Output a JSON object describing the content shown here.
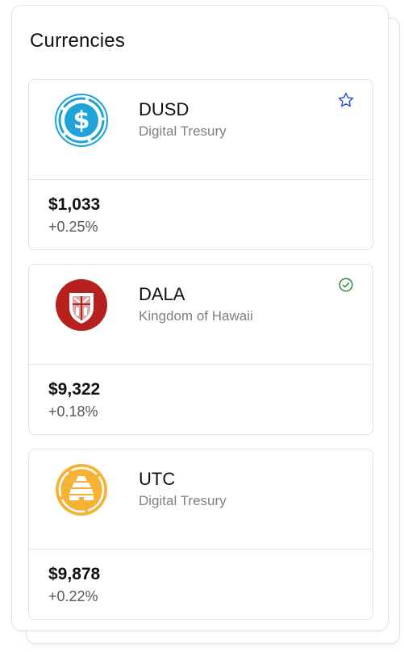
{
  "panel": {
    "title": "Currencies"
  },
  "currencies": [
    {
      "symbol": "DUSD",
      "issuer": "Digital Tresury",
      "price": "$1,033",
      "change": "+0.25%",
      "logo_icon": "dollar-coin-icon",
      "badge_icon": "star-outline-icon",
      "accent": "#1fa3d8"
    },
    {
      "symbol": "DALA",
      "issuer": "Kingdom of Hawaii",
      "price": "$9,322",
      "change": "+0.18%",
      "logo_icon": "hawaii-crest-icon",
      "badge_icon": "verified-check-icon",
      "accent": "#b6201e"
    },
    {
      "symbol": "UTC",
      "issuer": "Digital Tresury",
      "price": "$9,878",
      "change": "+0.22%",
      "logo_icon": "beehive-coin-icon",
      "badge_icon": "",
      "accent": "#f5b335"
    }
  ],
  "colors": {
    "star_blue": "#2b4fd6",
    "check_green": "#2e8b3e"
  }
}
